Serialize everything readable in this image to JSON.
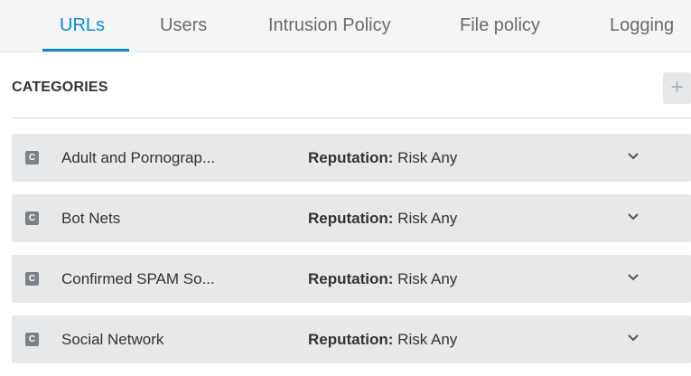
{
  "tabs": [
    {
      "label": "URLs",
      "active": true
    },
    {
      "label": "Users"
    },
    {
      "label": "Intrusion Policy"
    },
    {
      "label": "File policy"
    },
    {
      "label": "Logging"
    }
  ],
  "section": {
    "title": "CATEGORIES",
    "add_label": "+"
  },
  "categories": [
    {
      "badge": "C",
      "name": "Adult and Pornograp...",
      "rep_label": "Reputation:",
      "rep_value": " Risk Any"
    },
    {
      "badge": "C",
      "name": "Bot Nets",
      "rep_label": "Reputation:",
      "rep_value": " Risk Any"
    },
    {
      "badge": "C",
      "name": "Confirmed SPAM So...",
      "rep_label": "Reputation:",
      "rep_value": " Risk Any"
    },
    {
      "badge": "C",
      "name": "Social Network",
      "rep_label": "Reputation:",
      "rep_value": " Risk Any"
    }
  ],
  "colors": {
    "accent": "#0a8bd6",
    "row_bg": "#e6e8ea",
    "badge_bg": "#7c8289"
  }
}
